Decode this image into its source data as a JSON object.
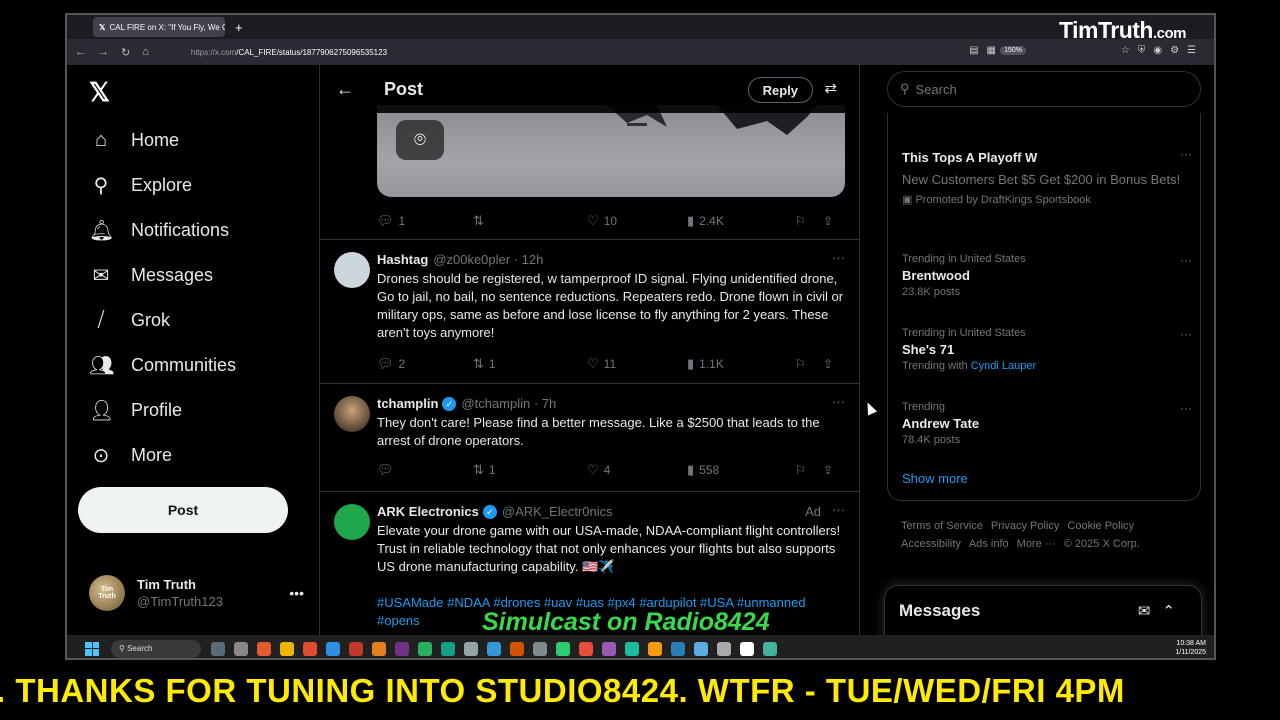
{
  "browser": {
    "tab_title": "CAL FIRE on X: \"If You Fly, We C",
    "url_domain": "https://x.com",
    "url_path": "/CAL_FIRE/status/1877906275096535123",
    "zoom": "150%",
    "watermark": "TimTruth",
    "watermark_suffix": ".com"
  },
  "nav": {
    "items": [
      {
        "label": "Home",
        "icon": "home-icon"
      },
      {
        "label": "Explore",
        "icon": "search-icon"
      },
      {
        "label": "Notifications",
        "icon": "bell-icon"
      },
      {
        "label": "Messages",
        "icon": "envelope-icon"
      },
      {
        "label": "Grok",
        "icon": "grok-icon"
      },
      {
        "label": "Communities",
        "icon": "people-icon"
      },
      {
        "label": "Profile",
        "icon": "person-icon"
      },
      {
        "label": "More",
        "icon": "more-circle-icon"
      }
    ],
    "post_label": "Post",
    "user_name": "Tim Truth",
    "user_handle": "@TimTruth123"
  },
  "main": {
    "title": "Post",
    "reply_label": "Reply",
    "original_actions": {
      "replies": "1",
      "reposts": "",
      "likes": "10",
      "views": "2.4K"
    },
    "tweets": [
      {
        "name": "Hashtag",
        "handle": "@z00ke0pler · 12h",
        "text": "Drones should be registered, w tamperproof ID signal. Flying unidentified drone, Go to jail, no bail, no sentence reductions. Repeaters redo. Drone flown in civil or military ops, same as before and lose license to fly anything for 2 years. These aren't toys anymore!",
        "replies": "2",
        "reposts": "1",
        "likes": "11",
        "views": "1.1K"
      },
      {
        "name": "tchamplin",
        "handle": "@tchamplin · 7h",
        "text": "They don't care!  Please find a better message.  Like a $2500 that leads to the arrest of drone operators.",
        "replies": "",
        "reposts": "1",
        "likes": "4",
        "views": "558"
      },
      {
        "name": "ARK Electronics",
        "handle": "@ARK_Electr0nics",
        "ad": "Ad",
        "text": "Elevate your drone game with our USA-made, NDAA-compliant flight controllers! Trust in reliable technology that not only enhances your flights but also supports US drone manufacturing capability. 🇺🇸✈️",
        "hashtags": "#USAMade #NDAA #drones #uav #uas #px4 #ardupilot #USA #unmanned #opens"
      }
    ]
  },
  "right": {
    "search_placeholder": "Search",
    "promo": {
      "title": "This Tops A Playoff W",
      "desc": "New Customers Bet $5 Get $200 in Bonus Bets!",
      "by": "Promoted by DraftKings Sportsbook"
    },
    "trends": [
      {
        "context": "Trending in United States",
        "title": "Brentwood",
        "sub": "23.8K posts"
      },
      {
        "context": "Trending in United States",
        "title": "She's 71",
        "sub": "Trending with",
        "sub_link": "Cyndi Lauper"
      },
      {
        "context": "Trending",
        "title": "Andrew Tate",
        "sub": "78.4K posts"
      }
    ],
    "show_more": "Show more",
    "footer": {
      "line1": [
        "Terms of Service",
        "Privacy Policy",
        "Cookie Policy"
      ],
      "line2": [
        "Accessibility",
        "Ads info",
        "More ···",
        "© 2025 X Corp."
      ]
    },
    "messages_title": "Messages"
  },
  "taskbar": {
    "search": "Search",
    "time": "10:38 AM",
    "date": "1/11/2025"
  },
  "overlay": {
    "simulcast": "Simulcast on Radio8424",
    "ticker": ".   THANKS FOR TUNING INTO STUDIO8424.    WTFR - TUE/WED/FRI 4PM"
  }
}
